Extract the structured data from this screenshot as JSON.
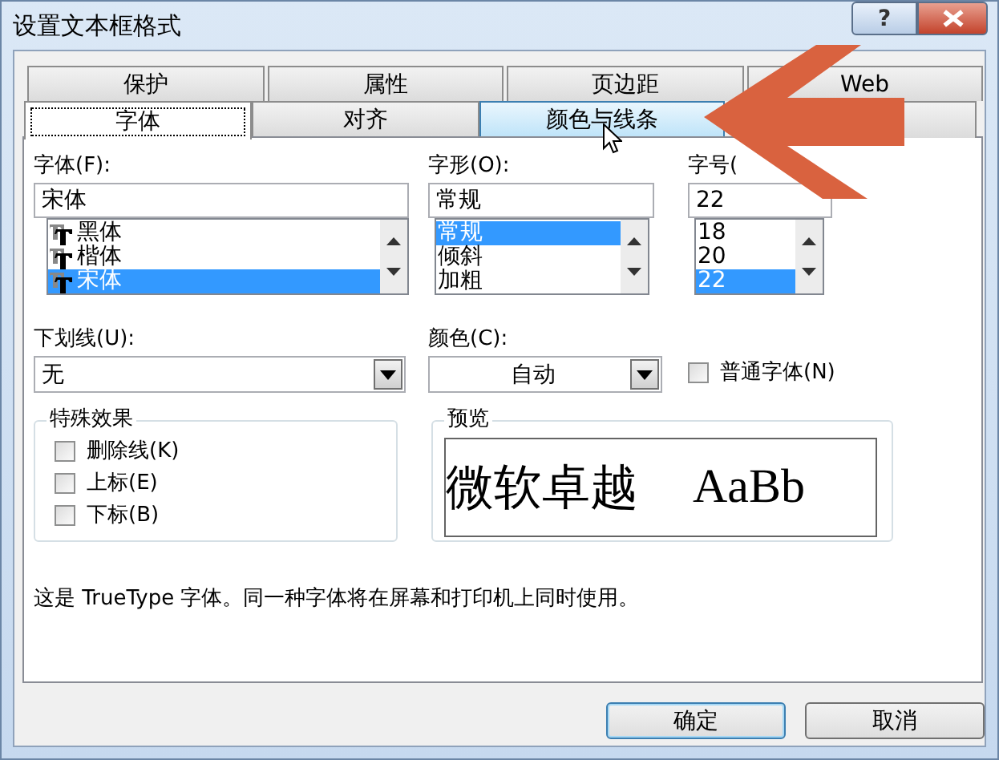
{
  "window": {
    "title": "设置文本框格式",
    "help": "?"
  },
  "tabs_back": [
    {
      "label": "保护",
      "selected": false
    },
    {
      "label": "属性",
      "selected": false
    },
    {
      "label": "页边距",
      "selected": false
    },
    {
      "label": "Web",
      "selected": false
    }
  ],
  "tabs_front": [
    {
      "label": "字体",
      "selected": true,
      "hovered": false
    },
    {
      "label": "对齐",
      "selected": false,
      "hovered": false
    },
    {
      "label": "颜色与线条",
      "selected": false,
      "hovered": true
    }
  ],
  "font": {
    "label": "字体(F):",
    "value": "宋体",
    "options": [
      {
        "label": "黑体",
        "selected": false
      },
      {
        "label": "楷体",
        "selected": false
      },
      {
        "label": "宋体",
        "selected": true
      }
    ]
  },
  "style": {
    "label": "字形(O):",
    "value": "常规",
    "options": [
      {
        "label": "常规",
        "selected": true
      },
      {
        "label": "倾斜",
        "selected": false
      },
      {
        "label": "加粗",
        "selected": false
      }
    ]
  },
  "size": {
    "label": "字号(",
    "value": "22",
    "options": [
      {
        "label": "18",
        "selected": false
      },
      {
        "label": "20",
        "selected": false
      },
      {
        "label": "22",
        "selected": true
      }
    ]
  },
  "underline": {
    "label": "下划线(U):",
    "value": "无"
  },
  "color": {
    "label": "颜色(C):",
    "value": "自动"
  },
  "normal_font": {
    "label": "普通字体(N)",
    "checked": false
  },
  "effects": {
    "title": "特殊效果",
    "items": [
      {
        "label": "删除线(K)",
        "checked": false
      },
      {
        "label": "上标(E)",
        "checked": false
      },
      {
        "label": "下标(B)",
        "checked": false
      }
    ]
  },
  "preview": {
    "title": "预览",
    "sample_cjk": "微软卓越",
    "sample_latin": "AaBb"
  },
  "note": "这是 TrueType 字体。同一种字体将在屏幕和打印机上同时使用。",
  "buttons": [
    {
      "label": "确定",
      "default": true
    },
    {
      "label": "取消",
      "default": false
    }
  ]
}
